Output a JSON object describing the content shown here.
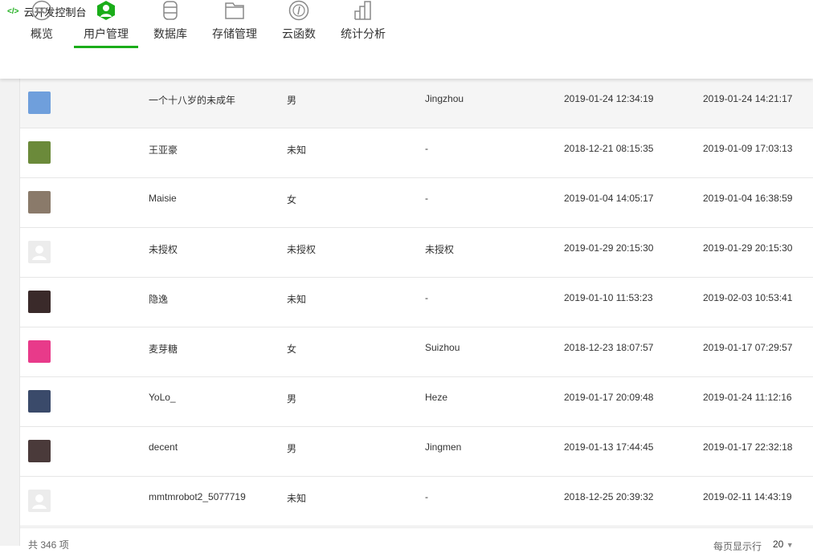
{
  "app": {
    "title": "云开发控制台",
    "icon": "code-icon"
  },
  "tabs": [
    {
      "label": "概览",
      "icon": "infinity-icon"
    },
    {
      "label": "用户管理",
      "icon": "user-icon",
      "active": true
    },
    {
      "label": "数据库",
      "icon": "database-icon"
    },
    {
      "label": "存储管理",
      "icon": "folder-icon"
    },
    {
      "label": "云函数",
      "icon": "function-icon"
    },
    {
      "label": "统计分析",
      "icon": "chart-icon"
    }
  ],
  "accent": "#1aad19",
  "users": [
    {
      "avatar": "#6f9fdc",
      "nickname": "一个十八岁的未成年",
      "gender": "男",
      "city": "Jingzhou",
      "created": "2019-01-24 12:34:19",
      "last_login": "2019-01-24 14:21:17"
    },
    {
      "avatar": "#6b8a3a",
      "nickname": "王亚豪",
      "gender": "未知",
      "city": "-",
      "created": "2018-12-21 08:15:35",
      "last_login": "2019-01-09 17:03:13"
    },
    {
      "avatar": "#8a7a6a",
      "nickname": "Maisie",
      "gender": "女",
      "city": "-",
      "created": "2019-01-04 14:05:17",
      "last_login": "2019-01-04 16:38:59"
    },
    {
      "avatar": "#ececec",
      "nickname": "未授权",
      "gender": "未授权",
      "city": "未授权",
      "created": "2019-01-29 20:15:30",
      "last_login": "2019-01-29 20:15:30"
    },
    {
      "avatar": "#3a2a2a",
      "nickname": "隐逸",
      "gender": "未知",
      "city": "-",
      "created": "2019-01-10 11:53:23",
      "last_login": "2019-02-03 10:53:41"
    },
    {
      "avatar": "#e83a8a",
      "nickname": "麦芽糖",
      "gender": "女",
      "city": "Suizhou",
      "created": "2018-12-23 18:07:57",
      "last_login": "2019-01-17 07:29:57"
    },
    {
      "avatar": "#3a4a6a",
      "nickname": "YoLo_",
      "gender": "男",
      "city": "Heze",
      "created": "2019-01-17 20:09:48",
      "last_login": "2019-01-24 11:12:16"
    },
    {
      "avatar": "#4a3a3a",
      "nickname": "decent",
      "gender": "男",
      "city": "Jingmen",
      "created": "2019-01-13 17:44:45",
      "last_login": "2019-01-17 22:32:18"
    },
    {
      "avatar": "#ececec",
      "nickname": "mmtmrobot2_5077719",
      "gender": "未知",
      "city": "-",
      "created": "2018-12-25 20:39:32",
      "last_login": "2019-02-11 14:43:19"
    }
  ],
  "footer": {
    "total": "共 346 项",
    "per_page_label": "每页显示行",
    "per_page": "20"
  }
}
